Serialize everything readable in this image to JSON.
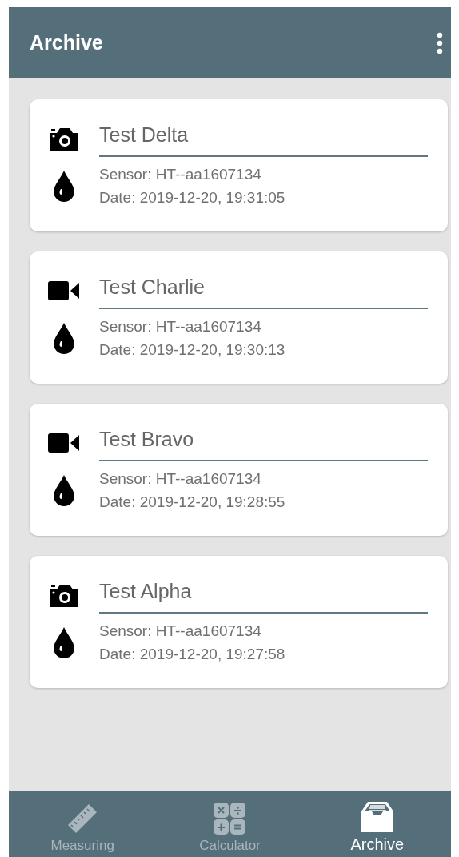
{
  "app_bar": {
    "title": "Archive"
  },
  "records": [
    {
      "kind": "photo",
      "name": "Test Delta",
      "sensor": "Sensor: HT--aa1607134",
      "date": "Date: 2019-12-20, 19:31:05"
    },
    {
      "kind": "video",
      "name": "Test Charlie",
      "sensor": "Sensor: HT--aa1607134",
      "date": "Date: 2019-12-20, 19:30:13"
    },
    {
      "kind": "video",
      "name": "Test Bravo",
      "sensor": "Sensor: HT--aa1607134",
      "date": "Date: 2019-12-20, 19:28:55"
    },
    {
      "kind": "photo",
      "name": "Test Alpha",
      "sensor": "Sensor: HT--aa1607134",
      "date": "Date: 2019-12-20, 19:27:58"
    }
  ],
  "bottom_nav": [
    {
      "kind": "ruler",
      "label": "Measuring",
      "selected": false
    },
    {
      "kind": "calculator",
      "label": "Calculator",
      "selected": false
    },
    {
      "kind": "archive",
      "label": "Archive",
      "selected": true
    }
  ]
}
